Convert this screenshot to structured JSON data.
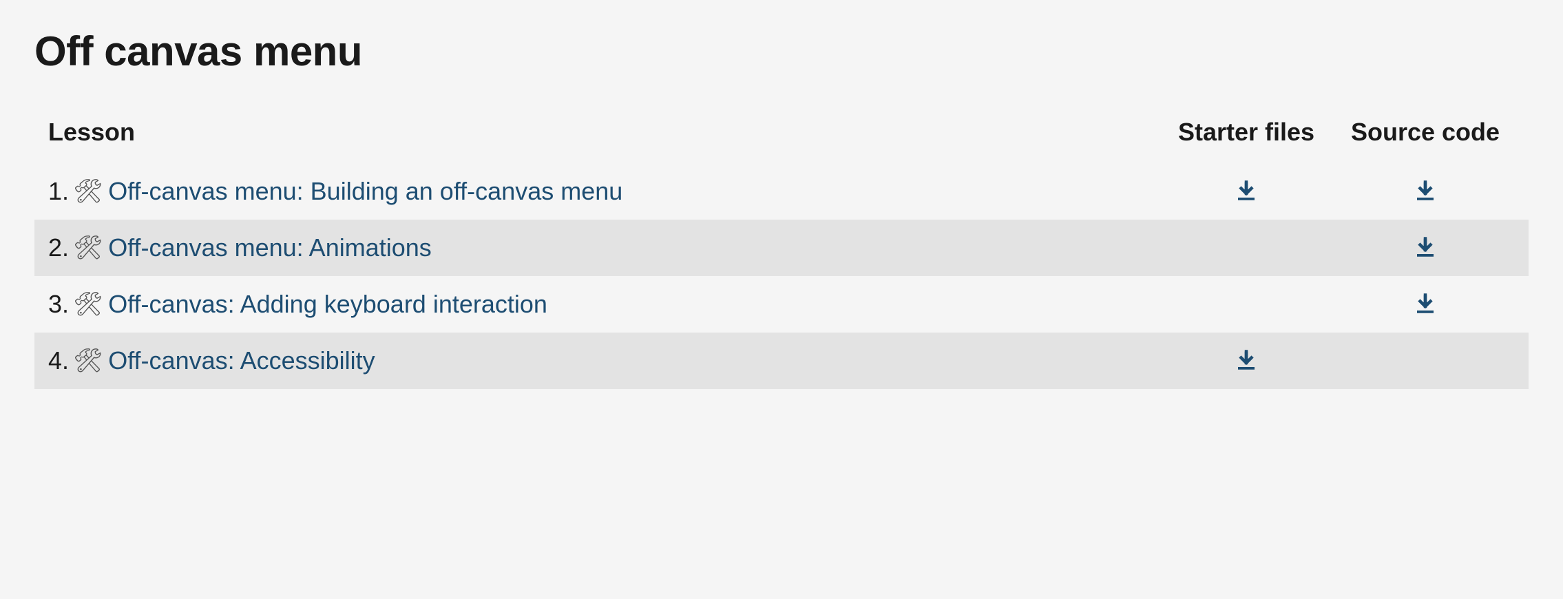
{
  "title": "Off canvas menu",
  "headers": {
    "lesson": "Lesson",
    "starter": "Starter files",
    "source": "Source code"
  },
  "link_color": "#1d4d72",
  "rows": [
    {
      "number": "1.",
      "icon": "🛠",
      "title": "Off-canvas menu: Building an off-canvas menu",
      "starter": true,
      "source": true
    },
    {
      "number": "2.",
      "icon": "🛠",
      "title": "Off-canvas menu: Animations",
      "starter": false,
      "source": true
    },
    {
      "number": "3.",
      "icon": "🛠",
      "title": "Off-canvas: Adding keyboard interaction",
      "starter": false,
      "source": true
    },
    {
      "number": "4.",
      "icon": "🛠",
      "title": "Off-canvas: Accessibility",
      "starter": true,
      "source": false
    }
  ]
}
